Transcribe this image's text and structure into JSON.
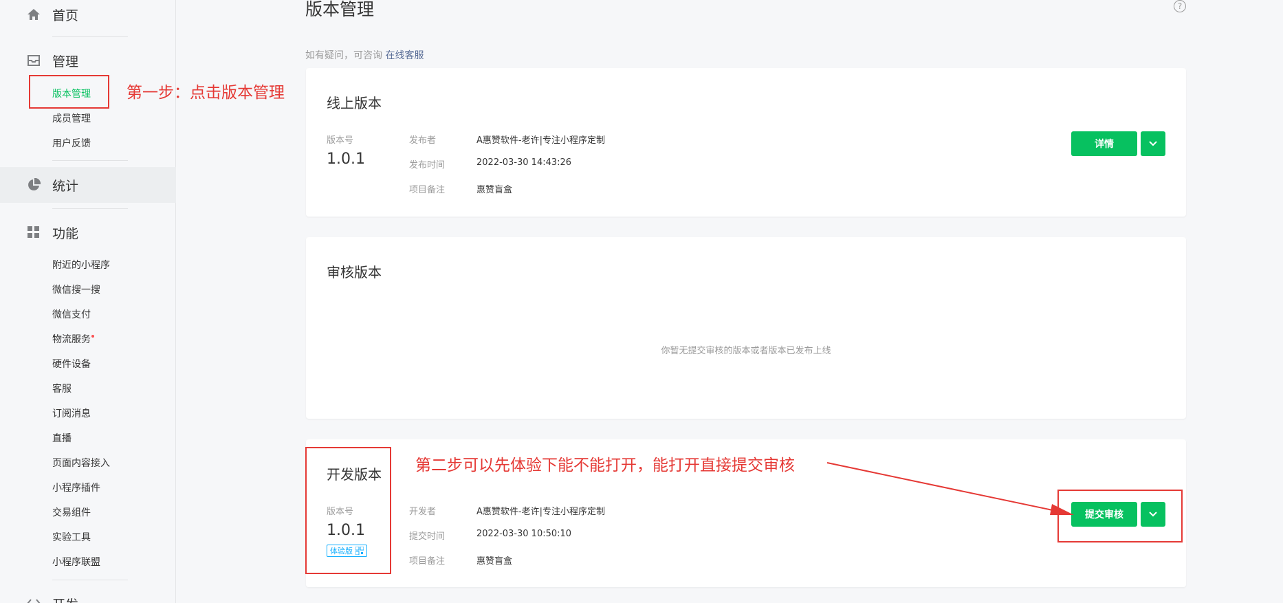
{
  "sidebar": {
    "home": {
      "label": "首页",
      "icon": "home-icon"
    },
    "manage": {
      "label": "管理",
      "icon": "inbox-icon",
      "items": [
        "版本管理",
        "成员管理",
        "用户反馈"
      ]
    },
    "stats": {
      "label": "统计",
      "icon": "pie-chart-icon"
    },
    "features": {
      "label": "功能",
      "icon": "grid-icon",
      "items": [
        "附近的小程序",
        "微信搜一搜",
        "微信支付",
        "物流服务",
        "硬件设备",
        "客服",
        "订阅消息",
        "直播",
        "页面内容接入",
        "小程序插件",
        "交易组件",
        "实验工具",
        "小程序联盟"
      ]
    },
    "dev": {
      "label": "开发",
      "icon": "code-icon"
    }
  },
  "page": {
    "title": "版本管理",
    "hint_prefix": "如有疑问，可咨询",
    "hint_link": "在线客服"
  },
  "online": {
    "title": "线上版本",
    "ver_label": "版本号",
    "version": "1.0.1",
    "publisher_k": "发布者",
    "publisher_v": "A惠赞软件-老许|专注小程序定制",
    "time_k": "发布时间",
    "time_v": "2022-03-30 14:43:26",
    "note_k": "项目备注",
    "note_v": "惠赞盲盒",
    "btn": "详情"
  },
  "review": {
    "title": "审核版本",
    "empty": "你暂无提交审核的版本或者版本已发布上线"
  },
  "dev": {
    "title": "开发版本",
    "ver_label": "版本号",
    "version": "1.0.1",
    "badge": "体验版",
    "dev_k": "开发者",
    "dev_v": "A惠赞软件-老许|专注小程序定制",
    "time_k": "提交时间",
    "time_v": "2022-03-30 10:50:10",
    "note_k": "项目备注",
    "note_v": "惠赞盲盒",
    "btn": "提交审核"
  },
  "annotations": {
    "step1": "第一步：点击版本管理",
    "step2": "第二步可以先体验下能不能打开，能打开直接提交审核"
  },
  "colors": {
    "accent": "#07c160",
    "annotation": "#e53935",
    "link": "#576b95"
  }
}
